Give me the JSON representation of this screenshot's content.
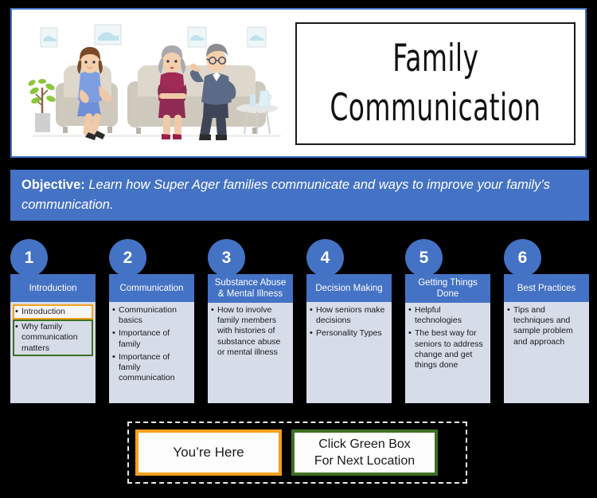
{
  "slide": {
    "title_lines": [
      "Family",
      "Communication"
    ],
    "illustration_alt": "family-conversation-illustration",
    "objective_label": "Objective:",
    "objective_text": " Learn how Super Ager families communicate and ways to improve your family’s communication."
  },
  "colors": {
    "accent_blue": "#4472C4",
    "body_bg": "#D6DCE8",
    "highlight_current": "#F5A01B",
    "highlight_next": "#3E7022",
    "slide_bg": "#000000",
    "panel_white": "#FFFFFF"
  },
  "columns": [
    {
      "number": "1",
      "header": "Introduction",
      "items": [
        {
          "text": "Introduction",
          "highlight": "orange"
        },
        {
          "text": "Why family communication matters",
          "highlight": "green"
        }
      ]
    },
    {
      "number": "2",
      "header": "Communication",
      "items": [
        {
          "text": "Communication basics",
          "highlight": "none"
        },
        {
          "text": "Importance of family",
          "highlight": "none"
        },
        {
          "text": "Importance of family communication",
          "highlight": "none"
        }
      ]
    },
    {
      "number": "3",
      "header": "Substance Abuse & Mental Illness",
      "items": [
        {
          "text": "How to involve family members with histories of substance abuse or mental illness",
          "highlight": "none"
        }
      ]
    },
    {
      "number": "4",
      "header": "Decision Making",
      "items": [
        {
          "text": "How seniors make decisions",
          "highlight": "none"
        },
        {
          "text": "Personality Types",
          "highlight": "none"
        }
      ]
    },
    {
      "number": "5",
      "header": "Getting Things Done",
      "items": [
        {
          "text": "Helpful technologies",
          "highlight": "none"
        },
        {
          "text": "The best way for seniors to address change and get things done",
          "highlight": "none"
        }
      ]
    },
    {
      "number": "6",
      "header": "Best Practices",
      "items": [
        {
          "text": "Tips and techniques and sample problem and approach",
          "highlight": "none"
        }
      ]
    }
  ],
  "legend": {
    "current_label": "You’re Here",
    "next_label_line1": "Click Green Box",
    "next_label_line2": "For Next Location"
  }
}
